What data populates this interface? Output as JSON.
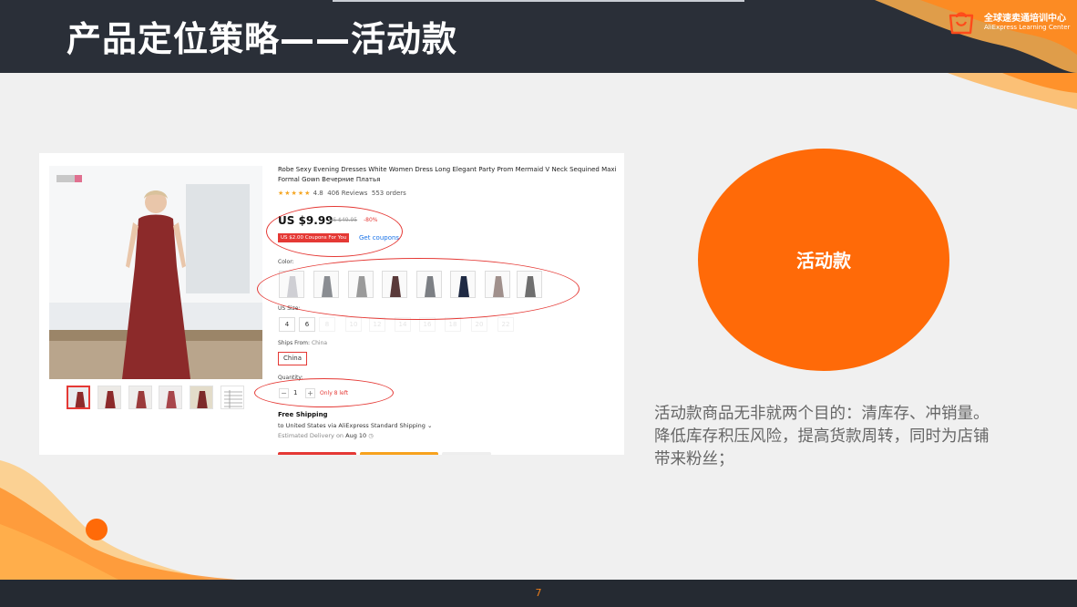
{
  "slide": {
    "title": "产品定位策略——活动款",
    "page_number": "7"
  },
  "logo": {
    "name_cn": "全球速卖通培训中心",
    "name_en": "AliExpress Learning Center",
    "brand_color": "#ff6a08"
  },
  "product": {
    "title": "Robe Sexy Evening Dresses White Women Dress Long Elegant Party Prom Mermaid V Neck Sequined Maxi Formal Gown Вечерние Платья",
    "stars": "★★★★★",
    "rating": "4.8",
    "reviews": "406 Reviews",
    "orders": "553 orders",
    "price": "US $9.99",
    "original_price": "US $49.95",
    "discount": "-80%",
    "coupon_label": "US $2.00 Coupons For You",
    "get_coupons": "Get coupons",
    "color_label": "Color:",
    "size_label": "US Size:",
    "sizes": [
      "4",
      "6",
      "8",
      "10",
      "12",
      "14",
      "16",
      "18",
      "20",
      "22"
    ],
    "ships_from_label": "Ships From:",
    "ships_from_value": "China",
    "ships_from_option": "China",
    "quantity_label": "Quantity:",
    "quantity": "1",
    "stock_note": "Only 8 left",
    "shipping_title": "Free Shipping",
    "shipping_route": "to United States via AliExpress Standard Shipping ⌄",
    "delivery_label": "Estimated Delivery on",
    "delivery_date": "Aug 10",
    "dress_color": "#8c2a2a"
  },
  "highlight": {
    "label": "活动款",
    "description": "活动款商品无非就两个目的：清库存、冲销量。降低库存积压风险，提高货款周转，同时为店铺带来粉丝；"
  },
  "colors": {
    "header_bg": "#2a2f38",
    "accent_orange": "#ff6a08",
    "annotation_red": "#e53935"
  }
}
